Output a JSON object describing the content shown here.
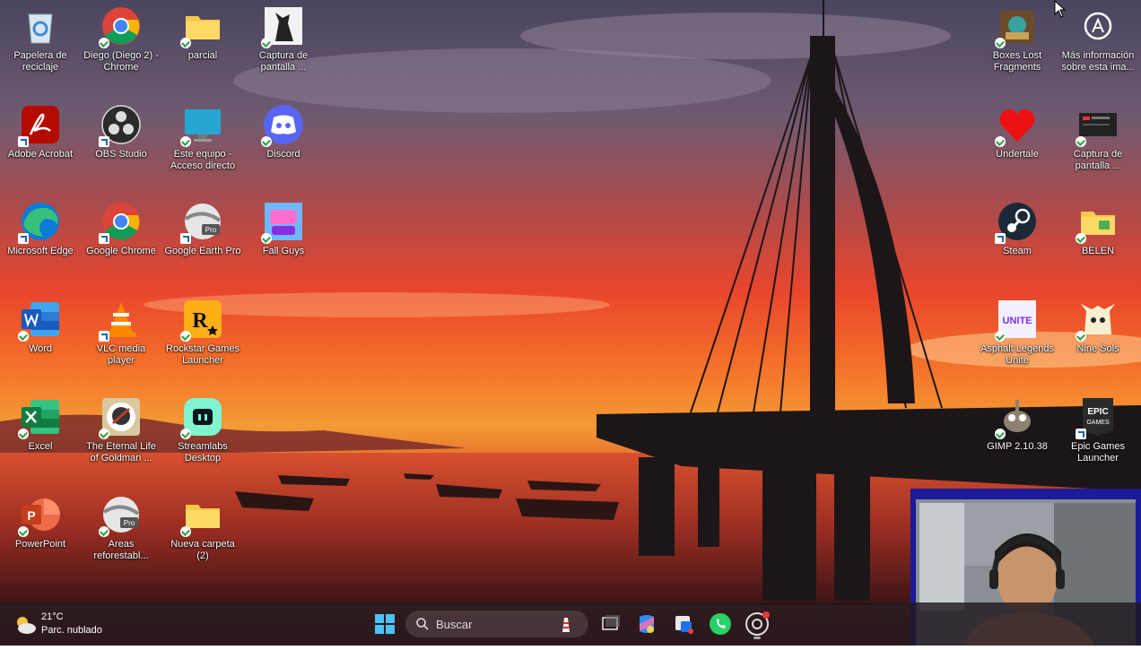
{
  "desktop_icons": [
    {
      "label": "Papelera de reciclaje",
      "icon": "recycle-bin-icon"
    },
    {
      "label": "Diego (Diego 2) - Chrome",
      "icon": "chrome-icon"
    },
    {
      "label": "parcial",
      "icon": "folder-icon"
    },
    {
      "label": "Captura de pantalla ...",
      "icon": "screenshot-cat-icon"
    },
    {
      "label": "Adobe Acrobat",
      "icon": "acrobat-icon"
    },
    {
      "label": "OBS Studio",
      "icon": "obs-icon"
    },
    {
      "label": "Este equipo - Acceso directo",
      "icon": "monitor-icon"
    },
    {
      "label": "Discord",
      "icon": "discord-icon"
    },
    {
      "label": "Microsoft Edge",
      "icon": "edge-icon"
    },
    {
      "label": "Google Chrome",
      "icon": "chrome-icon"
    },
    {
      "label": "Google Earth Pro",
      "icon": "google-earth-icon"
    },
    {
      "label": "Fall Guys",
      "icon": "fall-guys-icon"
    },
    {
      "label": "Word",
      "icon": "word-icon"
    },
    {
      "label": "VLC media player",
      "icon": "vlc-icon"
    },
    {
      "label": "Rockstar Games Launcher",
      "icon": "rockstar-icon"
    },
    {
      "label": "Excel",
      "icon": "excel-icon"
    },
    {
      "label": "The Eternal Life of Goldman ...",
      "icon": "eternal-life-icon"
    },
    {
      "label": "Streamlabs Desktop",
      "icon": "streamlabs-icon"
    },
    {
      "label": "PowerPoint",
      "icon": "powerpoint-icon"
    },
    {
      "label": "Areas reforestabl...",
      "icon": "google-earth-icon"
    },
    {
      "label": "Nueva carpeta (2)",
      "icon": "folder-icon"
    },
    {
      "label": "Boxes Lost Fragments",
      "icon": "boxes-game-icon"
    },
    {
      "label": "Más información sobre esta ima...",
      "icon": "camera-info-icon"
    },
    {
      "label": "Undertale",
      "icon": "undertale-heart-icon"
    },
    {
      "label": "Captura de pantalla ...",
      "icon": "screenshot-icon"
    },
    {
      "label": "Steam",
      "icon": "steam-icon"
    },
    {
      "label": "BELEN",
      "icon": "folder-icon"
    },
    {
      "label": "Asphalt Legends Unite",
      "icon": "asphalt-icon"
    },
    {
      "label": "Nine Sols",
      "icon": "nine-sols-icon"
    },
    {
      "label": "GIMP 2.10.38",
      "icon": "gimp-icon"
    },
    {
      "label": "Epic Games Launcher",
      "icon": "epic-games-icon"
    }
  ],
  "epic_logo_text": "EPIC GAMES",
  "google_earth_badge": "Pro",
  "taskbar": {
    "weather": {
      "temp": "21°C",
      "condition": "Parc. nublado"
    },
    "search_placeholder": "Buscar",
    "apps": [
      "start-icon",
      "lighthouse-icon",
      "task-view-icon",
      "copilot-icon",
      "capture-icon",
      "whatsapp-icon",
      "chrome-icon"
    ]
  },
  "colors": {
    "accent": "#0078d4",
    "webcam_border": "#1a1a9a"
  }
}
